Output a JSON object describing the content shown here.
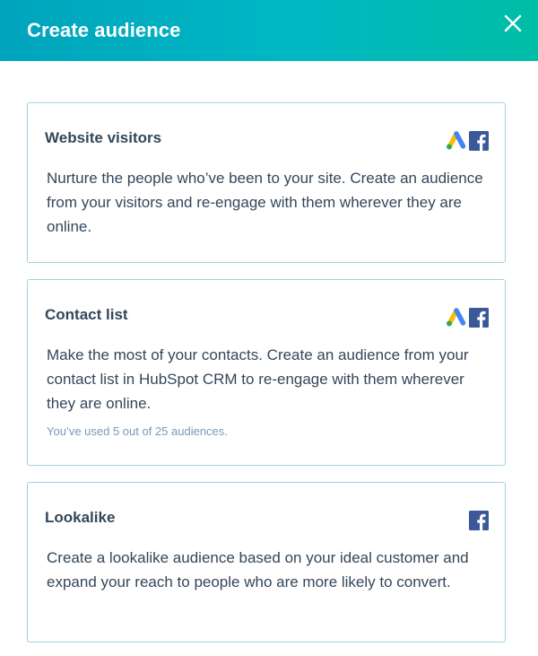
{
  "header": {
    "title": "Create audience",
    "close_icon": "close-icon"
  },
  "cards": [
    {
      "title": "Website visitors",
      "description": "Nurture the people who’ve been to your site. Create an audience from your visitors and re-engage with them wherever they are online.",
      "icons": [
        "google-ads-icon",
        "facebook-icon"
      ]
    },
    {
      "title": "Contact list",
      "description": "Make the most of your contacts. Create an audience from your contact list in HubSpot CRM to re-engage with them wherever they are online.",
      "note": "You’ve used 5 out of 25 audiences.",
      "icons": [
        "google-ads-icon",
        "facebook-icon"
      ]
    },
    {
      "title": "Lookalike",
      "description": "Create a lookalike audience based on your ideal customer and expand your reach to people who are more likely to convert.",
      "icons": [
        "facebook-icon"
      ]
    }
  ],
  "colors": {
    "header_gradient_start": "#00a4bd",
    "header_gradient_end": "#00bda5",
    "card_border": "#9fd3e0",
    "text": "#33475b",
    "note_text": "#7c98b6",
    "facebook_blue": "#3b5998"
  }
}
